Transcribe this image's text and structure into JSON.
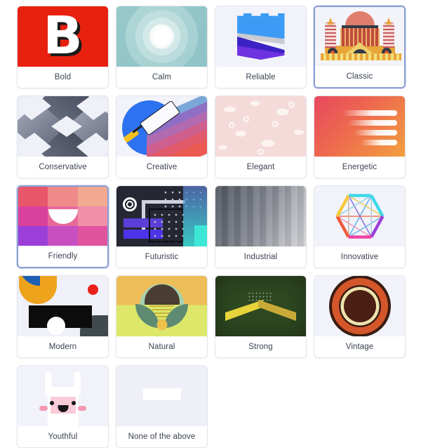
{
  "page": {
    "kind": "style-preference-card-grid",
    "background": "#ffffff",
    "selected_border_color": "#8c9fd4",
    "card_border_color": "#e3e6ec",
    "label_color": "#3b4252",
    "thumb_background": "#f2f3fa"
  },
  "cards": [
    {
      "id": "bold",
      "label": "Bold",
      "selected": false,
      "thumb": "bold-logo-thumbnail",
      "colors": [
        "#e8210f",
        "#ffffff",
        "#1a1a1a"
      ]
    },
    {
      "id": "calm",
      "label": "Calm",
      "selected": false,
      "thumb": "calm-glow-thumbnail",
      "colors": [
        "#ffffff",
        "#9fc9cf",
        "#d6ece2"
      ]
    },
    {
      "id": "reliable",
      "label": "Reliable",
      "selected": false,
      "thumb": "reliable-shield-thumbnail",
      "colors": [
        "#3d9bf5",
        "#6f32e0",
        "#c9cbd3"
      ]
    },
    {
      "id": "classic",
      "label": "Classic",
      "selected": true,
      "thumb": "classic-building-thumbnail",
      "colors": [
        "#e8a53a",
        "#c24a3c",
        "#e07e6e"
      ]
    },
    {
      "id": "conservative",
      "label": "Conservative",
      "selected": false,
      "thumb": "conservative-isometric-thumbnail",
      "colors": [
        "#4a5060",
        "#9ca3b8",
        "#f0f1f8"
      ]
    },
    {
      "id": "creative",
      "label": "Creative",
      "selected": false,
      "thumb": "creative-paint-roller-thumbnail",
      "colors": [
        "#2d72f0",
        "#f5c120",
        "#ea5a52"
      ]
    },
    {
      "id": "elegant",
      "label": "Elegant",
      "selected": false,
      "thumb": "elegant-damask-thumbnail",
      "colors": [
        "#f5dada",
        "#fdf3f1"
      ]
    },
    {
      "id": "energetic",
      "label": "Energetic",
      "selected": false,
      "thumb": "energetic-speed-lines-thumbnail",
      "colors": [
        "#e8485f",
        "#f2a03f",
        "#ffffff"
      ]
    },
    {
      "id": "friendly",
      "label": "Friendly",
      "selected": true,
      "thumb": "friendly-color-blocks-thumbnail",
      "colors": [
        "#e8566a",
        "#b44fd0",
        "#ffffff"
      ]
    },
    {
      "id": "futuristic",
      "label": "Futuristic",
      "selected": false,
      "thumb": "futuristic-circuit-thumbnail",
      "colors": [
        "#252733",
        "#4f33e8",
        "#3ee6d6"
      ]
    },
    {
      "id": "industrial",
      "label": "Industrial",
      "selected": false,
      "thumb": "industrial-metal-thumbnail",
      "colors": [
        "#4f5560",
        "#d3d4d8"
      ]
    },
    {
      "id": "innovative",
      "label": "Innovative",
      "selected": false,
      "thumb": "innovative-hexagon-network-thumbnail",
      "colors": [
        "#3ed8e8",
        "#f03fa0",
        "#f5c93a"
      ]
    },
    {
      "id": "modern",
      "label": "Modern",
      "selected": false,
      "thumb": "modern-geometric-thumbnail",
      "colors": [
        "#eda31c",
        "#1f5fb4",
        "#e8221a"
      ]
    },
    {
      "id": "natural",
      "label": "Natural",
      "selected": false,
      "thumb": "natural-landscape-thumbnail",
      "colors": [
        "#edbe58",
        "#dde86a",
        "#5e8a72"
      ]
    },
    {
      "id": "strong",
      "label": "Strong",
      "selected": false,
      "thumb": "strong-chevron-thumbnail",
      "colors": [
        "#2f4a22",
        "#e8d43a"
      ]
    },
    {
      "id": "vintage",
      "label": "Vintage",
      "selected": false,
      "thumb": "vintage-badge-thumbnail",
      "colors": [
        "#d4562a",
        "#3a1c12",
        "#efe3ae"
      ]
    },
    {
      "id": "youthful",
      "label": "Youthful",
      "selected": false,
      "thumb": "youthful-bunny-thumbnail",
      "colors": [
        "#f9ccd8",
        "#f59ab0",
        "#ffffff"
      ]
    },
    {
      "id": "none",
      "label": "None of the above",
      "selected": false,
      "thumb": "none-placeholder-thumbnail",
      "colors": [
        "#eeeff7",
        "#ffffff"
      ]
    }
  ]
}
